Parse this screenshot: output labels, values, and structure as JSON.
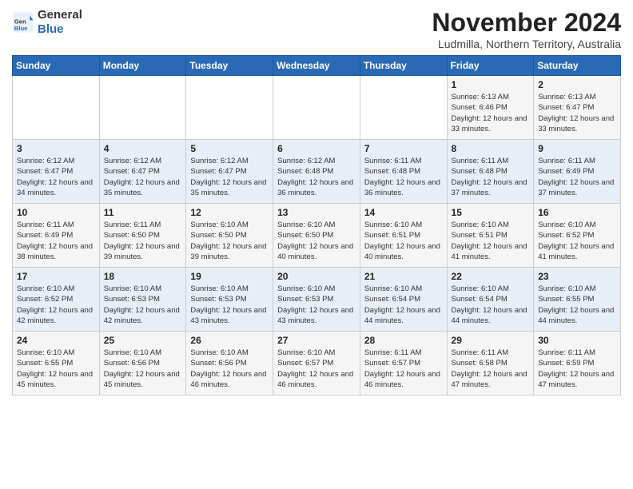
{
  "header": {
    "logo_line1": "General",
    "logo_line2": "Blue",
    "month": "November 2024",
    "location": "Ludmilla, Northern Territory, Australia"
  },
  "columns": [
    "Sunday",
    "Monday",
    "Tuesday",
    "Wednesday",
    "Thursday",
    "Friday",
    "Saturday"
  ],
  "weeks": [
    [
      {
        "day": "",
        "info": ""
      },
      {
        "day": "",
        "info": ""
      },
      {
        "day": "",
        "info": ""
      },
      {
        "day": "",
        "info": ""
      },
      {
        "day": "",
        "info": ""
      },
      {
        "day": "1",
        "info": "Sunrise: 6:13 AM\nSunset: 6:46 PM\nDaylight: 12 hours and 33 minutes."
      },
      {
        "day": "2",
        "info": "Sunrise: 6:13 AM\nSunset: 6:47 PM\nDaylight: 12 hours and 33 minutes."
      }
    ],
    [
      {
        "day": "3",
        "info": "Sunrise: 6:12 AM\nSunset: 6:47 PM\nDaylight: 12 hours and 34 minutes."
      },
      {
        "day": "4",
        "info": "Sunrise: 6:12 AM\nSunset: 6:47 PM\nDaylight: 12 hours and 35 minutes."
      },
      {
        "day": "5",
        "info": "Sunrise: 6:12 AM\nSunset: 6:47 PM\nDaylight: 12 hours and 35 minutes."
      },
      {
        "day": "6",
        "info": "Sunrise: 6:12 AM\nSunset: 6:48 PM\nDaylight: 12 hours and 36 minutes."
      },
      {
        "day": "7",
        "info": "Sunrise: 6:11 AM\nSunset: 6:48 PM\nDaylight: 12 hours and 36 minutes."
      },
      {
        "day": "8",
        "info": "Sunrise: 6:11 AM\nSunset: 6:48 PM\nDaylight: 12 hours and 37 minutes."
      },
      {
        "day": "9",
        "info": "Sunrise: 6:11 AM\nSunset: 6:49 PM\nDaylight: 12 hours and 37 minutes."
      }
    ],
    [
      {
        "day": "10",
        "info": "Sunrise: 6:11 AM\nSunset: 6:49 PM\nDaylight: 12 hours and 38 minutes."
      },
      {
        "day": "11",
        "info": "Sunrise: 6:11 AM\nSunset: 6:50 PM\nDaylight: 12 hours and 39 minutes."
      },
      {
        "day": "12",
        "info": "Sunrise: 6:10 AM\nSunset: 6:50 PM\nDaylight: 12 hours and 39 minutes."
      },
      {
        "day": "13",
        "info": "Sunrise: 6:10 AM\nSunset: 6:50 PM\nDaylight: 12 hours and 40 minutes."
      },
      {
        "day": "14",
        "info": "Sunrise: 6:10 AM\nSunset: 6:51 PM\nDaylight: 12 hours and 40 minutes."
      },
      {
        "day": "15",
        "info": "Sunrise: 6:10 AM\nSunset: 6:51 PM\nDaylight: 12 hours and 41 minutes."
      },
      {
        "day": "16",
        "info": "Sunrise: 6:10 AM\nSunset: 6:52 PM\nDaylight: 12 hours and 41 minutes."
      }
    ],
    [
      {
        "day": "17",
        "info": "Sunrise: 6:10 AM\nSunset: 6:52 PM\nDaylight: 12 hours and 42 minutes."
      },
      {
        "day": "18",
        "info": "Sunrise: 6:10 AM\nSunset: 6:53 PM\nDaylight: 12 hours and 42 minutes."
      },
      {
        "day": "19",
        "info": "Sunrise: 6:10 AM\nSunset: 6:53 PM\nDaylight: 12 hours and 43 minutes."
      },
      {
        "day": "20",
        "info": "Sunrise: 6:10 AM\nSunset: 6:53 PM\nDaylight: 12 hours and 43 minutes."
      },
      {
        "day": "21",
        "info": "Sunrise: 6:10 AM\nSunset: 6:54 PM\nDaylight: 12 hours and 44 minutes."
      },
      {
        "day": "22",
        "info": "Sunrise: 6:10 AM\nSunset: 6:54 PM\nDaylight: 12 hours and 44 minutes."
      },
      {
        "day": "23",
        "info": "Sunrise: 6:10 AM\nSunset: 6:55 PM\nDaylight: 12 hours and 44 minutes."
      }
    ],
    [
      {
        "day": "24",
        "info": "Sunrise: 6:10 AM\nSunset: 6:55 PM\nDaylight: 12 hours and 45 minutes."
      },
      {
        "day": "25",
        "info": "Sunrise: 6:10 AM\nSunset: 6:56 PM\nDaylight: 12 hours and 45 minutes."
      },
      {
        "day": "26",
        "info": "Sunrise: 6:10 AM\nSunset: 6:56 PM\nDaylight: 12 hours and 46 minutes."
      },
      {
        "day": "27",
        "info": "Sunrise: 6:10 AM\nSunset: 6:57 PM\nDaylight: 12 hours and 46 minutes."
      },
      {
        "day": "28",
        "info": "Sunrise: 6:11 AM\nSunset: 6:57 PM\nDaylight: 12 hours and 46 minutes."
      },
      {
        "day": "29",
        "info": "Sunrise: 6:11 AM\nSunset: 6:58 PM\nDaylight: 12 hours and 47 minutes."
      },
      {
        "day": "30",
        "info": "Sunrise: 6:11 AM\nSunset: 6:59 PM\nDaylight: 12 hours and 47 minutes."
      }
    ]
  ]
}
